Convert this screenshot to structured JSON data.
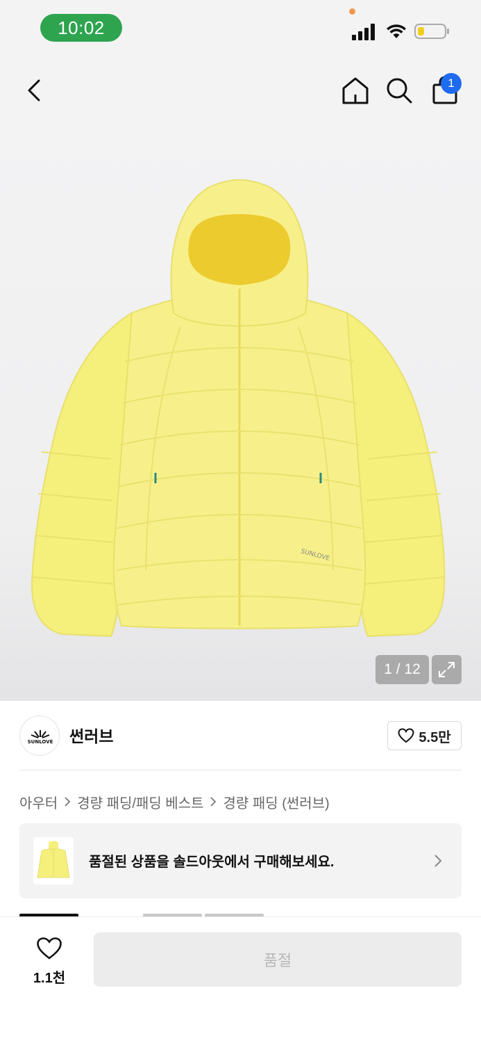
{
  "status_bar": {
    "time": "10:02",
    "icons": [
      "signal-icon",
      "wifi-icon",
      "battery-icon"
    ]
  },
  "nav": {
    "icons": [
      "back-arrow-icon",
      "home-icon",
      "search-icon",
      "shopping-bag-icon"
    ],
    "cart_badge": "1"
  },
  "gallery": {
    "counter": "1 / 12",
    "expand_icon": "expand-icon",
    "accent_color": "#f6ee8a"
  },
  "brand": {
    "name": "썬러브",
    "logo_text": "SUNLOVE",
    "likes": "5.5만"
  },
  "breadcrumb": [
    "아우터",
    "경량 패딩/패딩 베스트",
    "경량 패딩 (썬러브)"
  ],
  "soldout_banner": {
    "text": "품절된 상품을 솔드아웃에서 구매해보세요."
  },
  "bottom_bar": {
    "wish_count": "1.1천",
    "button_label": "품절"
  }
}
